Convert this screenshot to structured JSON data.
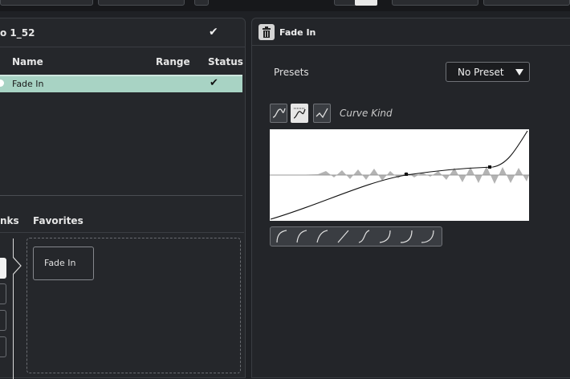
{
  "left_panel": {
    "title": "o 1_52",
    "columns": {
      "name": "Name",
      "range": "Range",
      "status": "Status"
    },
    "rows": [
      {
        "name": "Fade In",
        "status": "✔"
      }
    ],
    "tabs": {
      "links": "nks",
      "favorites": "Favorites"
    },
    "card_label": "Fade In"
  },
  "right_panel": {
    "title": "Fade In",
    "presets_label": "Presets",
    "preset_value": "No Preset",
    "curve_kind_label": "Curve Kind"
  },
  "colors": {
    "selected_row": "#a8d3c4",
    "panel_bg": "#25272b"
  },
  "icons": [
    "trash-icon",
    "checkmark-icon",
    "dropdown-arrow-icon",
    "spline-curve-icon",
    "damped-spline-icon",
    "linear-curve-icon"
  ]
}
